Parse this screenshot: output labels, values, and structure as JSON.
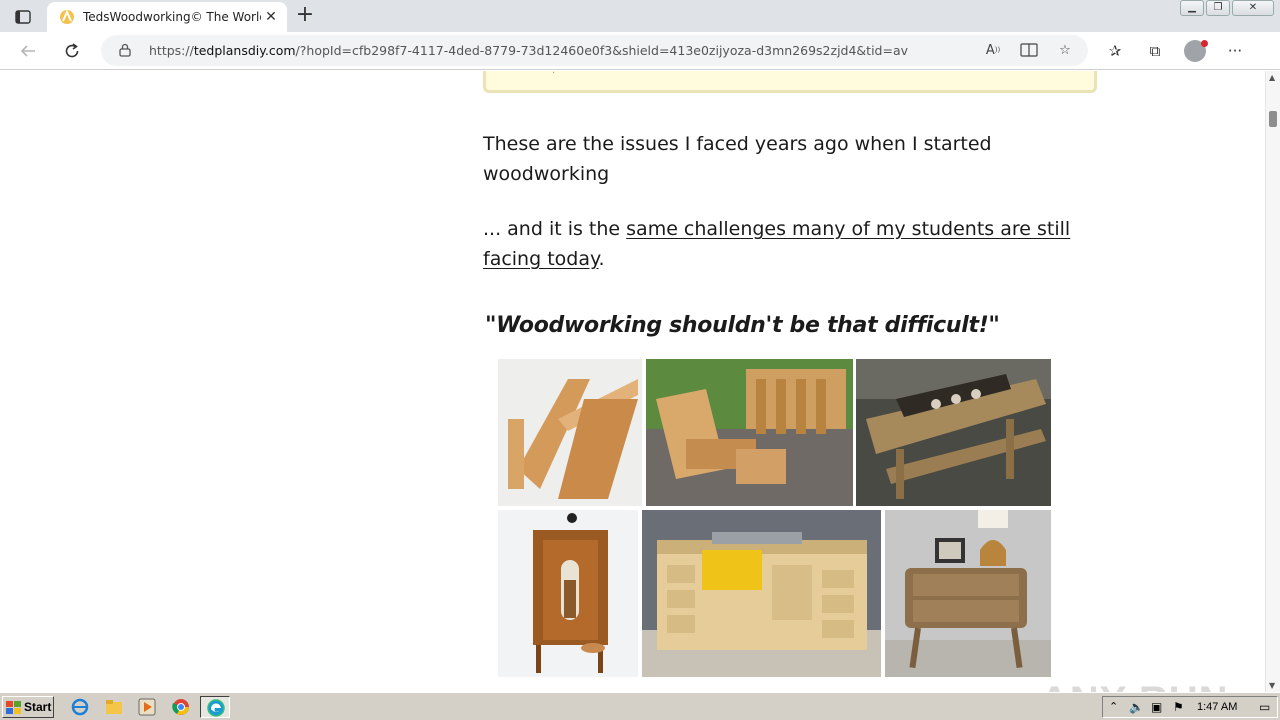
{
  "browser": {
    "tab": {
      "title": "TedsWoodworking© The World's"
    },
    "address": {
      "url_prefix": "https://",
      "url_domain": "tedplansdiy.com",
      "url_path": "/?hopId=cfb298f7-4117-4ded-8779-73d12460e0f3&shield=413e0zijyoza-d3mn269s2zjd4&tid=av"
    }
  },
  "page": {
    "callout_dot": ".",
    "para1": "These are the issues I faced years ago when I started woodworking",
    "para2_prefix": "... and it is the ",
    "para2_link": "same challenges many of my students are still facing today",
    "para2_suffix": ".",
    "headline": "\"Woodworking shouldn't be that difficult!\"",
    "photos": [
      "modern-wood-chair",
      "adirondack-chairs",
      "picnic-table",
      "wooden-dispenser",
      "table-saw-workbench",
      "nightstand"
    ]
  },
  "watermark": "ANY RUN",
  "taskbar": {
    "start_label": "Start",
    "clock": "1:47 AM"
  },
  "colors": {
    "callout_bg": "#fffbdc",
    "callout_border": "#e9e3b6",
    "text": "#1b1b1b"
  }
}
